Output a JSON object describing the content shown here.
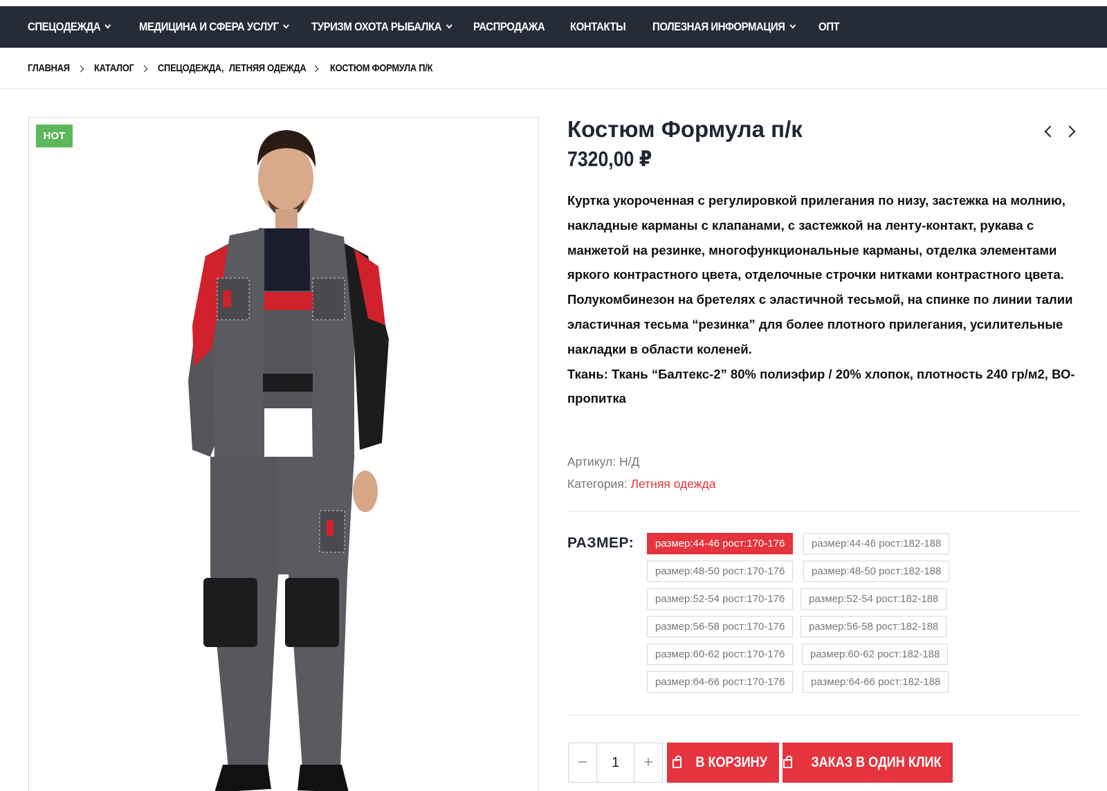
{
  "nav": {
    "items": [
      {
        "label": "СПЕЦОДЕЖДА",
        "dropdown": true
      },
      {
        "label": "МЕДИЦИНА И СФЕРА УСЛУГ",
        "dropdown": true
      },
      {
        "label": "ТУРИЗМ ОХОТА РЫБАЛКА",
        "dropdown": true
      },
      {
        "label": "РАСПРОДАЖА",
        "dropdown": false
      },
      {
        "label": "КОНТАКТЫ",
        "dropdown": false
      },
      {
        "label": "ПОЛЕЗНАЯ ИНФОРМАЦИЯ",
        "dropdown": true
      },
      {
        "label": "ОПТ",
        "dropdown": false
      }
    ]
  },
  "breadcrumb": {
    "home": "ГЛАВНАЯ",
    "catalog": "КАТАЛОГ",
    "category1": "СПЕЦОДЕЖДА,",
    "category2": "ЛЕТНЯЯ ОДЕЖДА",
    "current": "КОСТЮМ ФОРМУЛА П/К"
  },
  "product": {
    "badge": "HOT",
    "title": "Костюм Формула п/к",
    "price": "7320,00 ₽",
    "description": [
      "Куртка укороченная с регулировкой прилегания по низу, застежка на молнию, накладные карманы с клапанами, с застежкой на ленту-контакт, рукава с манжетой на резинке, многофункциональные карманы, отделка элементами яркого контрастного цвета, отделочные строчки нитками контрастного цвета.",
      "Полукомбинезон на бретелях с эластичной тесьмой, на спинке по линии талии эластичная тесьма “резинка” для более плотного прилегания, усилительные накладки в области коленей.",
      "Ткань: Ткань “Балтекс-2” 80% полиэфир / 20% хлопок, плотность 240 гр/м2, ВО-пропитка"
    ],
    "sku_label": "Артикул:",
    "sku_value": "Н/Д",
    "category_label": "Категория:",
    "category_value": "Летняя одежда",
    "size_label": "РАЗМЕР:",
    "sizes": [
      {
        "label": "размер:44-46 рост:170-176",
        "selected": true
      },
      {
        "label": "размер:44-46 рост:182-188",
        "selected": false
      },
      {
        "label": "размер:48-50 рост:170-176",
        "selected": false
      },
      {
        "label": "размер:48-50 рост:182-188",
        "selected": false
      },
      {
        "label": "размер:52-54 рост:170-176",
        "selected": false
      },
      {
        "label": "размер:52-54 рост:182-188",
        "selected": false
      },
      {
        "label": "размер:56-58 рост:170-176",
        "selected": false
      },
      {
        "label": "размер:56-58 рост:182-188",
        "selected": false
      },
      {
        "label": "размер:60-62 рост:170-176",
        "selected": false
      },
      {
        "label": "размер:60-62 рост:182-188",
        "selected": false
      },
      {
        "label": "размер:64-66 рост:170-176",
        "selected": false
      },
      {
        "label": "размер:64-66 рост:182-188",
        "selected": false
      }
    ],
    "quantity": "1",
    "add_to_cart": "В КОРЗИНУ",
    "one_click": "ЗАКАЗ В ОДИН КЛИК"
  },
  "colors": {
    "nav_bg": "#252b37",
    "accent": "#e5343e",
    "badge": "#5cb85c"
  }
}
